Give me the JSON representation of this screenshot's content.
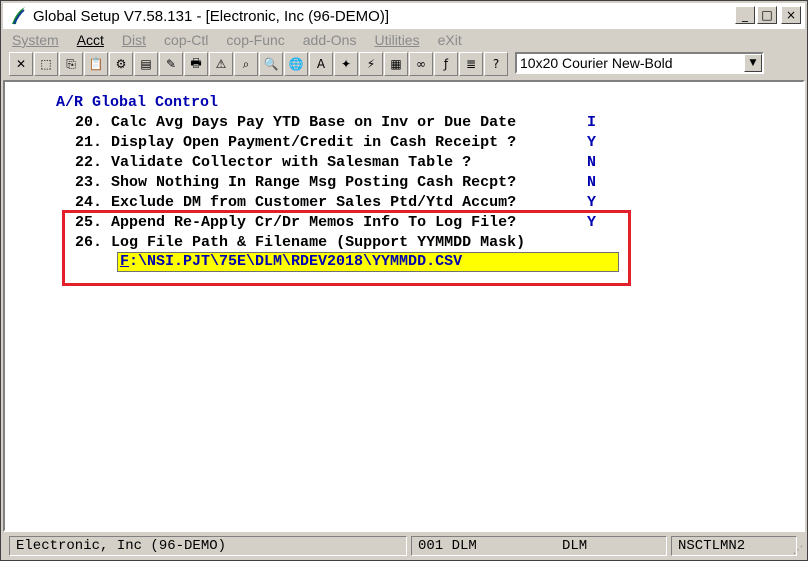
{
  "window": {
    "title": "Global Setup V7.58.131 - [Electronic, Inc (96-DEMO)]",
    "controls": {
      "minimize": "_",
      "maximize": "□",
      "close": "×"
    }
  },
  "menu": [
    {
      "label": "System",
      "enabled": false
    },
    {
      "label": "Acct",
      "enabled": true
    },
    {
      "label": "Dist",
      "enabled": false
    },
    {
      "label": "cop-Ctl",
      "enabled": false
    },
    {
      "label": "cop-Func",
      "enabled": false
    },
    {
      "label": "add-Ons",
      "enabled": false
    },
    {
      "label": "Utilities",
      "enabled": false
    },
    {
      "label": "eXit",
      "enabled": false
    }
  ],
  "toolbar": {
    "icons": [
      "close-x-icon",
      "select-icon",
      "copy-icon",
      "paste-icon",
      "settings-icon",
      "properties-icon",
      "notes-icon",
      "print-icon",
      "alert-icon",
      "binoculars-icon",
      "magnifier-icon",
      "globe-icon",
      "font-icon",
      "wizard-icon",
      "lightning-icon",
      "calculator-icon",
      "link-icon",
      "function-icon",
      "list-icon",
      "help-icon"
    ],
    "glyphs": [
      "✕",
      "⬚",
      "⎘",
      "📋",
      "⚙",
      "▤",
      "✎",
      "🖶",
      "⚠",
      "⌕",
      "🔍",
      "🌐",
      "A",
      "✦",
      "⚡",
      "▦",
      "∞",
      "ƒ",
      "≣",
      "?"
    ],
    "font_select": "10x20 Courier New-Bold"
  },
  "content": {
    "section_title": "A/R Global Control",
    "rows": [
      {
        "num": "20.",
        "label": "Calc Avg Days Pay YTD Base on Inv or Due Date",
        "flag": "I"
      },
      {
        "num": "21.",
        "label": "Display Open Payment/Credit in Cash Receipt ?",
        "flag": "Y"
      },
      {
        "num": "22.",
        "label": "Validate Collector with Salesman Table ?",
        "flag": "N"
      },
      {
        "num": "23.",
        "label": "Show Nothing In Range Msg Posting Cash Recpt?",
        "flag": "N"
      },
      {
        "num": "24.",
        "label": "Exclude DM from Customer Sales Ptd/Ytd Accum?",
        "flag": "Y"
      },
      {
        "num": "25.",
        "label": "Append Re-Apply Cr/Dr Memos Info To Log File?",
        "flag": "Y"
      },
      {
        "num": "26.",
        "label": "Log File Path & Filename (Support YYMMDD Mask)",
        "flag": ""
      }
    ],
    "path_value_first": "F",
    "path_value_rest": ":\\NSI.PJT\\75E\\DLM\\RDEV2018\\YYMMDD.CSV",
    "highlight_color": "#e3202a"
  },
  "status": {
    "company": "Electronic, Inc (96-DEMO)",
    "user_code": "001 DLM",
    "user": "DLM",
    "program": "NSCTLMN2"
  }
}
